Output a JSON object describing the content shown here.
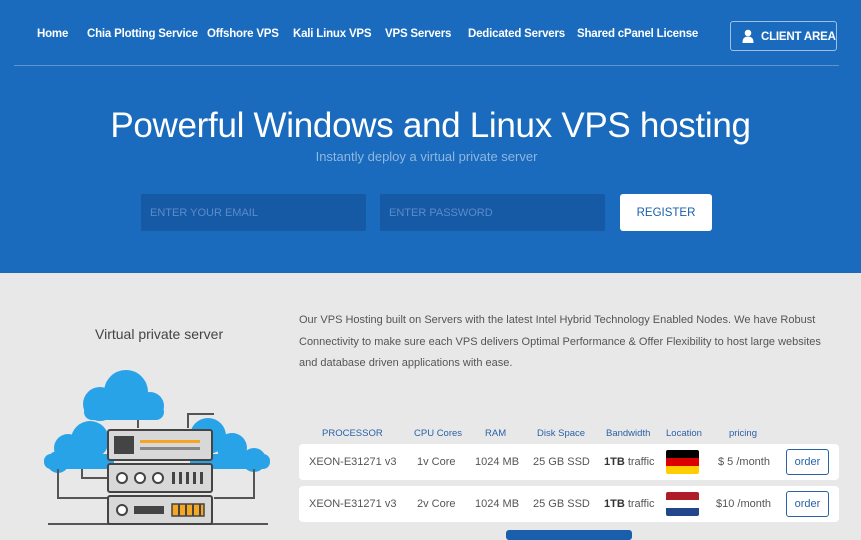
{
  "nav": {
    "items": [
      "Home",
      "Chia Plotting Service",
      "Offshore VPS",
      "Kali Linux VPS",
      "VPS Servers",
      "Dedicated Servers",
      "Shared cPanel License"
    ],
    "client_area": "CLIENT AREA"
  },
  "hero": {
    "title": "Powerful Windows and Linux VPS hosting",
    "subtitle": "Instantly deploy a virtual private server",
    "email_placeholder": "ENTER YOUR EMAIL",
    "password_placeholder": "ENTER PASSWORD",
    "register_label": "REGISTER"
  },
  "section": {
    "title": "Virtual private server",
    "description": "Our VPS Hosting built on Servers with the latest Intel Hybrid Technology Enabled Nodes. We have Robust Connectivity to make sure each VPS delivers Optimal Performance & Offer Flexibility to host large websites and database driven applications with ease."
  },
  "table": {
    "headers": [
      "PROCESSOR",
      "CPU Cores",
      "RAM",
      "Disk Space",
      "Bandwidth",
      "Location",
      "pricing"
    ],
    "rows": [
      {
        "processor": "XEON-E31271 v3",
        "cores": "1v Core",
        "ram": "1024 MB",
        "disk": "25 GB SSD",
        "bandwidth_bold": "1TB",
        "bandwidth_rest": " traffic",
        "location": "germany-flag",
        "price": "$ 5 /month",
        "order": "order"
      },
      {
        "processor": "XEON-E31271 v3",
        "cores": "2v Core",
        "ram": "1024 MB",
        "disk": "25 GB SSD",
        "bandwidth_bold": "1TB",
        "bandwidth_rest": " traffic",
        "location": "netherlands-flag",
        "price": "$10 /month",
        "order": "order"
      }
    ]
  },
  "colors": {
    "hero_bg": "#1a6bbd",
    "accent": "#2a62a6",
    "page_bg": "#e8e8e8"
  }
}
